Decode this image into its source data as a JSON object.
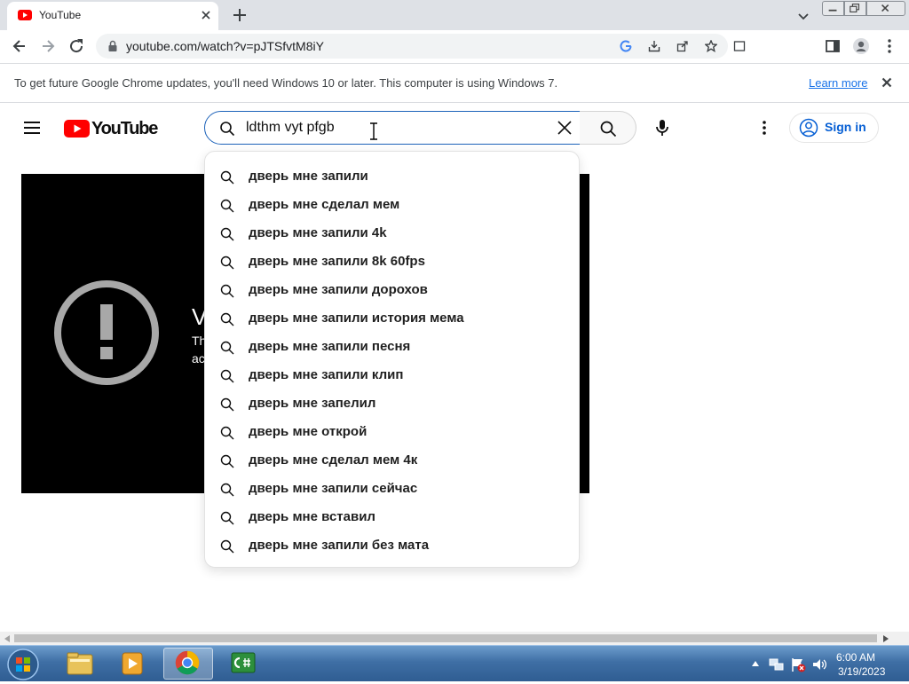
{
  "browser": {
    "tab": {
      "title": "YouTube"
    },
    "address": {
      "url": "youtube.com/watch?v=pJTSfvtM8iY"
    }
  },
  "infobar": {
    "message": "To get future Google Chrome updates, you'll need Windows 10 or later. This computer is using Windows 7.",
    "learn_more": "Learn more"
  },
  "youtube": {
    "logo_text": "YouTube",
    "search": {
      "value": "ldthm vyt pfgb"
    },
    "sign_in": "Sign in",
    "player": {
      "error_title_fragment": "V",
      "error_line1_fragment": "Th",
      "error_line2_fragment": "ac"
    },
    "suggestions": [
      "дверь мне запили",
      "дверь мне сделал мем",
      "дверь мне запили 4k",
      "дверь мне запили 8k 60fps",
      "дверь мне запили дорохов",
      "дверь мне запили история мема",
      "дверь мне запили песня",
      "дверь мне запили клип",
      "дверь мне запелил",
      "дверь мне открой",
      "дверь мне сделал мем 4к",
      "дверь мне запили сейчас",
      "дверь мне вставил",
      "дверь мне запили без мата"
    ]
  },
  "taskbar": {
    "time": "6:00 AM",
    "date": "3/19/2023"
  },
  "colors": {
    "youtube_red": "#ff0000",
    "link_blue": "#065fd4",
    "chrome_tabstrip": "#dee1e6"
  }
}
